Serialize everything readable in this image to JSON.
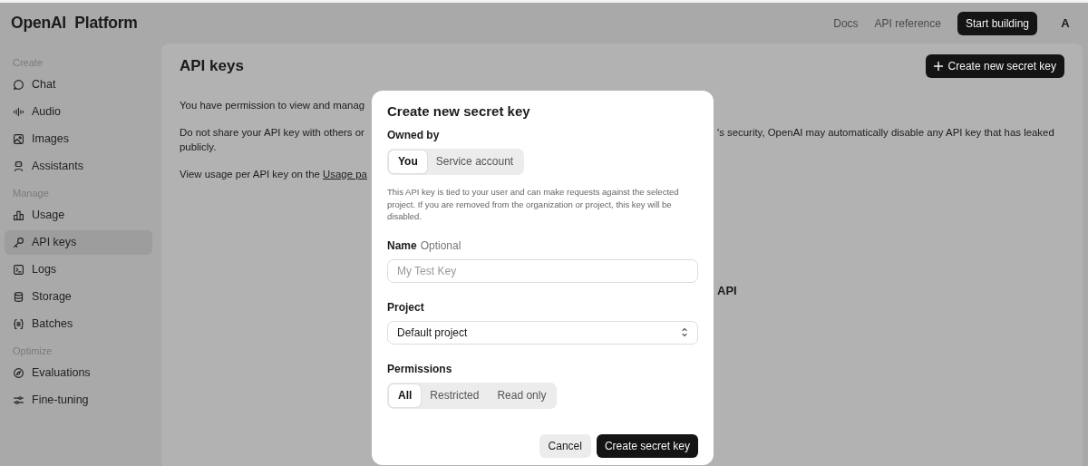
{
  "topbar": {
    "logo": "OpenAI  Platform",
    "links": [
      "Docs",
      "API reference"
    ],
    "primary_button": "Start building",
    "avatar": "A"
  },
  "sidebar": {
    "sections": [
      {
        "title": "Create",
        "items": [
          {
            "label": "Chat",
            "selected": false
          },
          {
            "label": "Audio",
            "selected": false
          },
          {
            "label": "Images",
            "selected": false
          },
          {
            "label": "Assistants",
            "selected": false
          }
        ]
      },
      {
        "title": "Manage",
        "items": [
          {
            "label": "Usage",
            "selected": false
          },
          {
            "label": "API keys",
            "selected": true
          },
          {
            "label": "Logs",
            "selected": false
          },
          {
            "label": "Storage",
            "selected": false
          },
          {
            "label": "Batches",
            "selected": false
          }
        ]
      },
      {
        "title": "Optimize",
        "items": [
          {
            "label": "Evaluations",
            "selected": false
          },
          {
            "label": "Fine-tuning",
            "selected": false
          }
        ]
      }
    ]
  },
  "main": {
    "title": "API keys",
    "create_button": "Create new secret key",
    "rows": [
      {
        "kind": "text",
        "left": "You have permission to view and manag"
      },
      {
        "kind": "text",
        "left": "Do not share your API key with others or",
        "right": "'s security, OpenAI may automatically disable any API key that has leaked"
      },
      {
        "kind": "text",
        "left": "publicly."
      },
      {
        "kind": "text",
        "left": "View usage per API key on the ",
        "link": "Usage pa"
      },
      {
        "kind": "heading",
        "right": "API"
      }
    ]
  },
  "modal": {
    "title": "Create new secret key",
    "owned_by": {
      "label": "Owned by",
      "options": [
        {
          "label": "You",
          "selected": true
        },
        {
          "label": "Service account",
          "selected": false
        }
      ]
    },
    "description": "This API key is tied to your user and can make requests against the selected project. If you are removed from the organization or project, this key will be disabled.",
    "name_field": {
      "label": "Name",
      "hint": "Optional",
      "placeholder": "My Test Key"
    },
    "project": {
      "label": "Project",
      "value": "Default project"
    },
    "permissions": {
      "label": "Permissions",
      "options": [
        {
          "label": "All",
          "selected": true
        },
        {
          "label": "Restricted",
          "selected": false
        },
        {
          "label": "Read only",
          "selected": false
        }
      ]
    },
    "cancel_button": "Cancel",
    "submit_button": "Create secret key"
  }
}
